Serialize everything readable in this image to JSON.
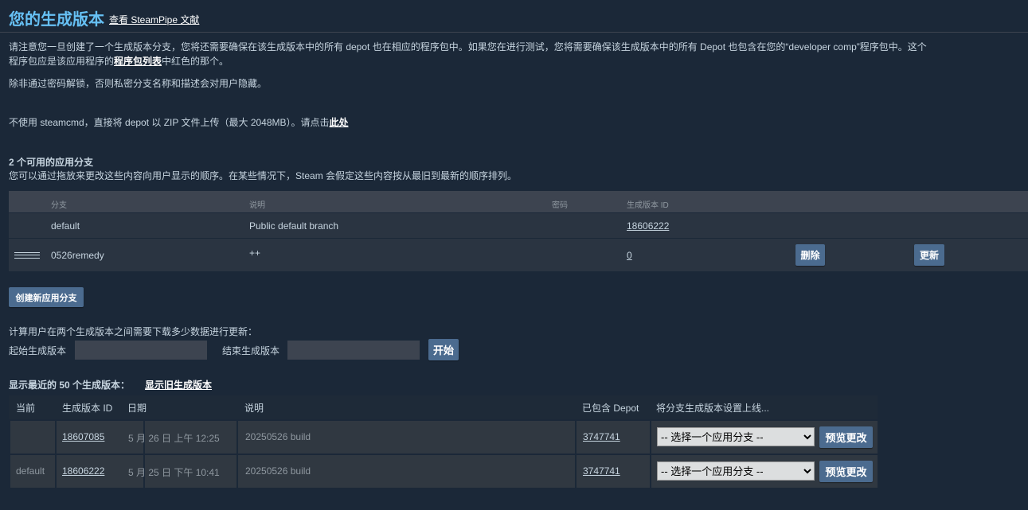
{
  "header": {
    "title": "您的生成版本",
    "doc_link": "查看 SteamPipe 文献"
  },
  "notice": {
    "line1_a": "请注意您一旦创建了一个生成版本分支，您将还需要确保在该生成版本中的所有 depot 也在相应的程序包中。如果您在进行测试，您将需要确保该生成版本中的所有 Depot 也包含在您的“developer comp”程序包中。这个",
    "line2_a": "程序包应是该应用程序的",
    "line2_link": "程序包列表",
    "line2_b": "中红色的那个。",
    "line3": "除非通过密码解锁，否则私密分支名称和描述会对用户隐藏。",
    "zip_text": "不使用 steamcmd，直接将 depot 以 ZIP 文件上传（最大 2048MB）。请点击",
    "zip_link": "此处"
  },
  "branches": {
    "title": "2 个可用的应用分支",
    "subtitle": "您可以通过拖放来更改这些内容向用户显示的顺序。在某些情况下，Steam 会假定这些内容按从最旧到最新的顺序排列。",
    "headers": {
      "branch": "分支",
      "description": "说明",
      "password": "密码",
      "build_id": "生成版本 ID"
    },
    "rows": [
      {
        "branch": "default",
        "description": "Public default branch",
        "build_id": "18606222"
      },
      {
        "branch": "0526remedy",
        "description": "++",
        "build_id": "0",
        "delete_label": "删除",
        "update_label": "更新"
      }
    ],
    "create_label": "创建新应用分支"
  },
  "diff": {
    "label": "计算用户在两个生成版本之间需要下载多少数据进行更新：",
    "start_label": "起始生成版本",
    "end_label": "结束生成版本",
    "start_value": "",
    "end_value": "",
    "go_label": "开始"
  },
  "builds": {
    "title": "显示最近的 50 个生成版本：",
    "old_link": "显示旧生成版本",
    "headers": {
      "current": "当前",
      "build_id": "生成版本 ID",
      "date": "日期",
      "description": "说明",
      "depots": "已包含 Depot",
      "set_live": "将分支生成版本设置上线..."
    },
    "rows": [
      {
        "current": "",
        "build_id": "18607085",
        "date": "5 月 26 日 上午 12:25",
        "description": "20250526 build",
        "depots": "3747741",
        "select": "-- 选择一个应用分支 --",
        "preview": "预览更改"
      },
      {
        "current": "default",
        "build_id": "18606222",
        "date": "5 月 25 日 下午 10:41",
        "description": "20250526 build",
        "depots": "3747741",
        "select": "-- 选择一个应用分支 --",
        "preview": "预览更改"
      }
    ]
  }
}
